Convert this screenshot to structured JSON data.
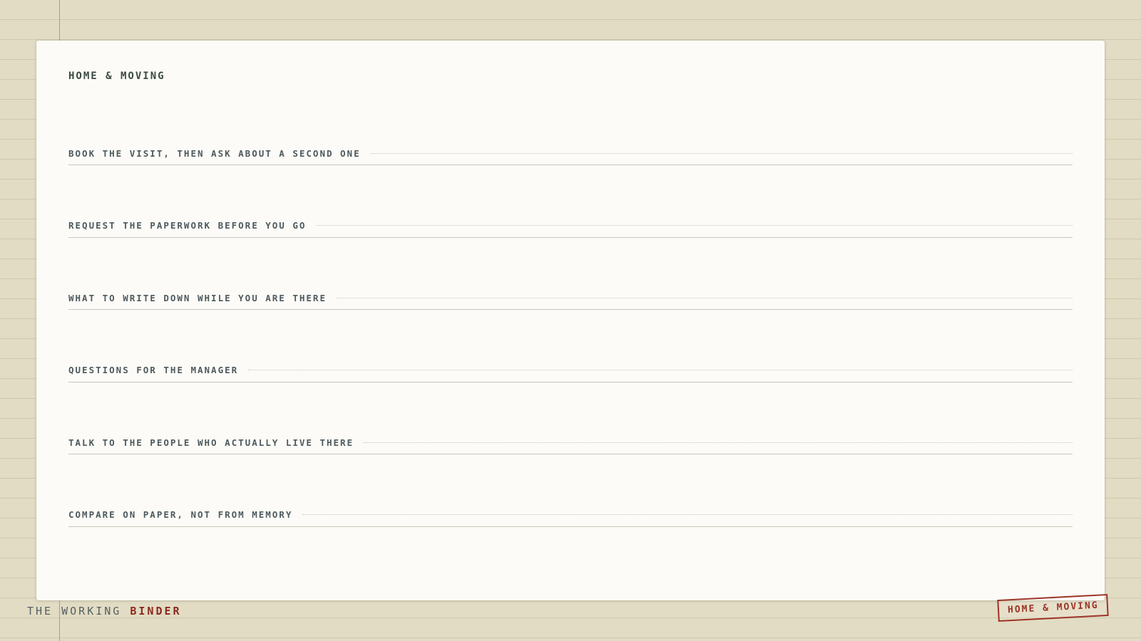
{
  "header": {
    "title": "HOME & MOVING"
  },
  "sections": [
    {
      "label": "BOOK THE VISIT, THEN ASK ABOUT A SECOND ONE"
    },
    {
      "label": "REQUEST THE PAPERWORK BEFORE YOU GO"
    },
    {
      "label": "WHAT TO WRITE DOWN WHILE YOU ARE THERE"
    },
    {
      "label": "QUESTIONS FOR THE MANAGER"
    },
    {
      "label": "TALK TO THE PEOPLE WHO ACTUALLY LIVE THERE"
    },
    {
      "label": "COMPARE ON PAPER, NOT FROM MEMORY"
    }
  ],
  "footer": {
    "brand_prefix": "THE WORKING ",
    "brand_accent": "BINDER",
    "stamp": "HOME & MOVING"
  },
  "colors": {
    "background": "#e2dcc4",
    "sheet": "#fcfbf7",
    "margin_rule": "#d48a7f",
    "accent_red": "#8b2a1f",
    "title_text": "#3b4a42"
  }
}
